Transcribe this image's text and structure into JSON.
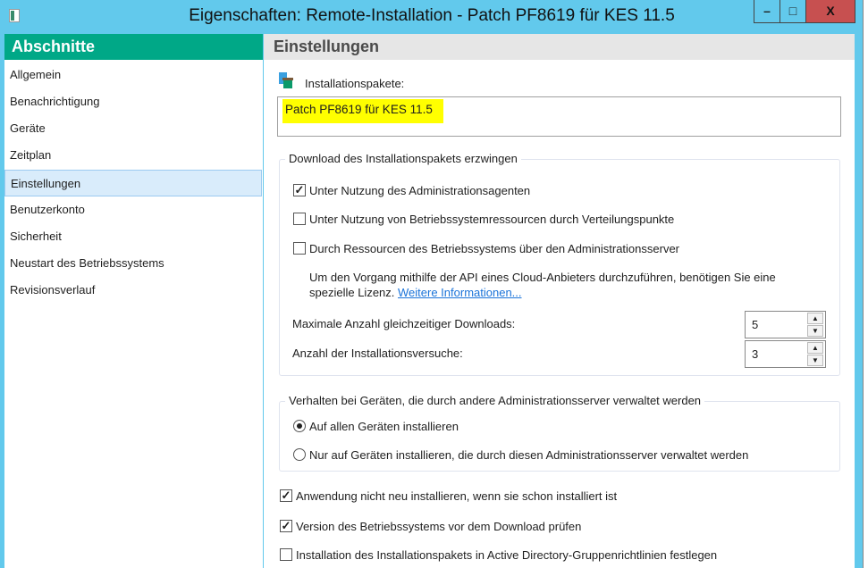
{
  "window": {
    "title": "Eigenschaften: Remote-Installation - Patch PF8619 für KES 11.5",
    "min": "–",
    "max": "□",
    "close": "X"
  },
  "sidebar": {
    "title": "Abschnitte",
    "items": [
      {
        "label": "Allgemein"
      },
      {
        "label": "Benachrichtigung"
      },
      {
        "label": "Geräte"
      },
      {
        "label": "Zeitplan"
      },
      {
        "label": "Einstellungen"
      },
      {
        "label": "Benutzerkonto"
      },
      {
        "label": "Sicherheit"
      },
      {
        "label": "Neustart des Betriebssystems"
      },
      {
        "label": "Revisionsverlauf"
      }
    ],
    "selected": "Einstellungen"
  },
  "main": {
    "title": "Einstellungen",
    "packages_label": "Installationspakete:",
    "package_value": "Patch PF8619 für KES 11.5",
    "download_group": {
      "legend": "Download des Installationspakets erzwingen",
      "options": [
        {
          "label": "Unter Nutzung des Administrationsagenten",
          "checked": true
        },
        {
          "label": "Unter Nutzung von Betriebssystemressourcen durch Verteilungspunkte",
          "checked": false
        },
        {
          "label": "Durch Ressourcen des Betriebssystems über den Administrationsserver",
          "checked": false
        }
      ],
      "info_line1": "Um den Vorgang mithilfe der API eines Cloud-Anbieters durchzuführen, benötigen Sie eine",
      "info_line2": "spezielle Lizenz.",
      "info_link": "Weitere Informationen...",
      "max_downloads_label": "Maximale Anzahl gleichzeitiger Downloads:",
      "max_downloads": "5",
      "attempts_label": "Anzahl der Installationsversuche:",
      "attempts": "3"
    },
    "behavior_group": {
      "legend": "Verhalten bei Geräten, die durch andere Administrationsserver verwaltet werden",
      "options": [
        {
          "label": "Auf allen Geräten installieren",
          "selected": true
        },
        {
          "label": "Nur auf Geräten installieren, die durch diesen Administrationsserver verwaltet werden",
          "selected": false
        }
      ]
    },
    "bottom_options": [
      {
        "label": "Anwendung nicht neu installieren, wenn sie schon installiert ist",
        "checked": true
      },
      {
        "label": "Version des Betriebssystems vor dem Download prüfen",
        "checked": true
      },
      {
        "label": "Installation des Installationspakets in Active Directory-Gruppenrichtlinien festlegen",
        "checked": false
      }
    ]
  },
  "colors": {
    "titlebar": "#62c9ec",
    "sidebar_header": "#00a887",
    "highlight": "#ffff00",
    "close": "#c75050"
  }
}
